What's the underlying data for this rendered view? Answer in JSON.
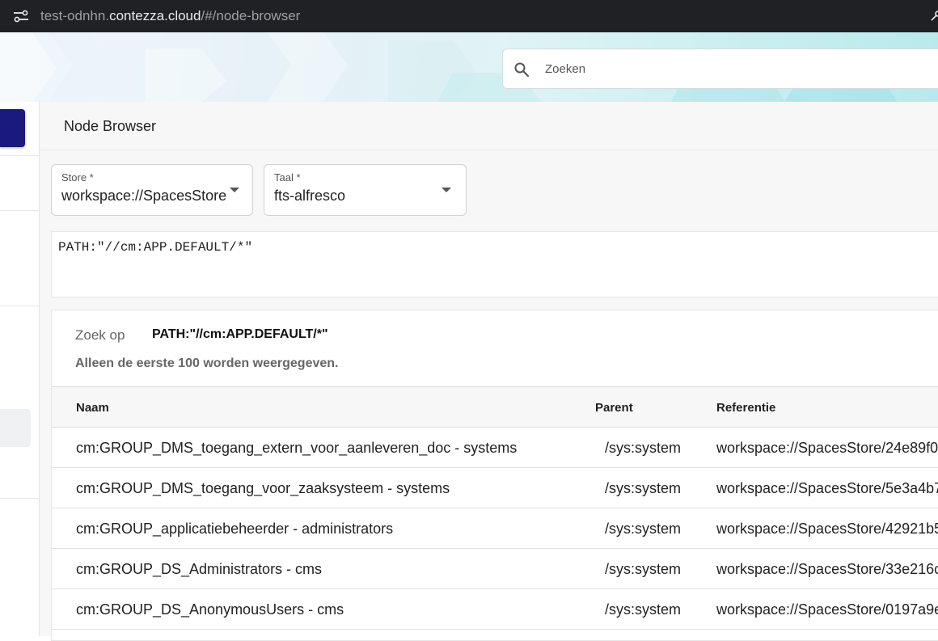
{
  "browser": {
    "url_prefix": "test-odnhn.",
    "url_domain": "contezza.cloud",
    "url_path": "/#/node-browser"
  },
  "header": {
    "search": {
      "placeholder": "Zoeken",
      "icon": "search-icon"
    }
  },
  "page": {
    "title": "Node Browser"
  },
  "filters": {
    "store": {
      "label": "Store *",
      "value": "workspace://SpacesStore"
    },
    "language": {
      "label": "Taal *",
      "value": "fts-alfresco"
    }
  },
  "query": {
    "text": "PATH:\"//cm:APP.DEFAULT/*\""
  },
  "results": {
    "search_label": "Zoek op",
    "search_value": "PATH:\"//cm:APP.DEFAULT/*\"",
    "note": "Alleen de eerste 100 worden weergegeven.",
    "columns": {
      "name": "Naam",
      "parent": "Parent",
      "reference": "Referentie"
    },
    "rows": [
      {
        "name": "cm:GROUP_DMS_toegang_extern_voor_aanleveren_doc - systems",
        "parent": "/sys:system",
        "reference": "workspace://SpacesStore/24e89f0"
      },
      {
        "name": "cm:GROUP_DMS_toegang_voor_zaaksysteem - systems",
        "parent": "/sys:system",
        "reference": "workspace://SpacesStore/5e3a4b7"
      },
      {
        "name": "cm:GROUP_applicatiebeheerder - administrators",
        "parent": "/sys:system",
        "reference": "workspace://SpacesStore/42921b5"
      },
      {
        "name": "cm:GROUP_DS_Administrators - cms",
        "parent": "/sys:system",
        "reference": "workspace://SpacesStore/33e216c"
      },
      {
        "name": "cm:GROUP_DS_AnonymousUsers - cms",
        "parent": "/sys:system",
        "reference": "workspace://SpacesStore/0197a9e"
      }
    ]
  },
  "colors": {
    "browser_bar": "#202124",
    "primary": "#1a1a7e",
    "header_accent": "#b8e9ec"
  }
}
